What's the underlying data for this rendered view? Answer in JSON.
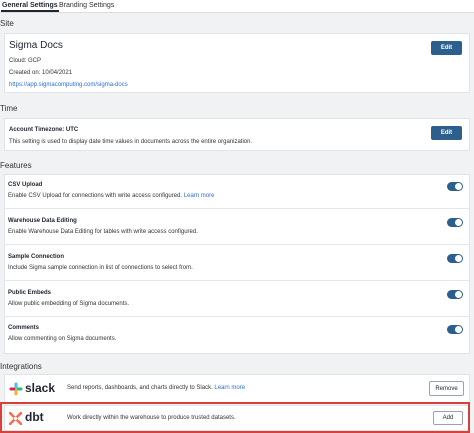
{
  "tabs": [
    {
      "label": "General Settings",
      "active": true
    },
    {
      "label": "Branding Settings",
      "active": false
    }
  ],
  "site": {
    "section_title": "Site",
    "name": "Sigma Docs",
    "cloud": "Cloud: GCP",
    "created": "Created on: 10/04/2021",
    "url": "https://app.sigmacomputing.com/sigma-docs",
    "edit_label": "Edit"
  },
  "time": {
    "section_title": "Time",
    "timezone_label": "Account Timezone: UTC",
    "description": "This setting is used to display date time values in documents across the entire organization.",
    "edit_label": "Edit"
  },
  "features": {
    "section_title": "Features",
    "items": [
      {
        "title": "CSV Upload",
        "desc": "Enable CSV Upload for connections with write access configured.",
        "link": "Learn more",
        "enabled": true
      },
      {
        "title": "Warehouse Data Editing",
        "desc": "Enable Warehouse Data Editing for tables with write access configured.",
        "link": "",
        "enabled": true
      },
      {
        "title": "Sample Connection",
        "desc": "Include Sigma sample connection in list of connections to select from.",
        "link": "",
        "enabled": true
      },
      {
        "title": "Public Embeds",
        "desc": "Allow public embedding of Sigma documents.",
        "link": "",
        "enabled": true
      },
      {
        "title": "Comments",
        "desc": "Allow commenting on Sigma documents.",
        "link": "",
        "enabled": true
      }
    ]
  },
  "integrations": {
    "section_title": "Integrations",
    "items": [
      {
        "name": "slack",
        "desc": "Send reports, dashboards, and charts directly to Slack.",
        "link": "Learn more",
        "button": "Remove",
        "icon": "slack-icon"
      },
      {
        "name": "dbt",
        "desc": "Work directly within the warehouse to produce trusted datasets.",
        "link": "",
        "button": "Add",
        "icon": "dbt-icon"
      }
    ]
  },
  "colors": {
    "accent": "#2c5f8e",
    "link": "#2a6fd6",
    "highlight": "#d9403a",
    "dbt_orange": "#ff694a"
  }
}
